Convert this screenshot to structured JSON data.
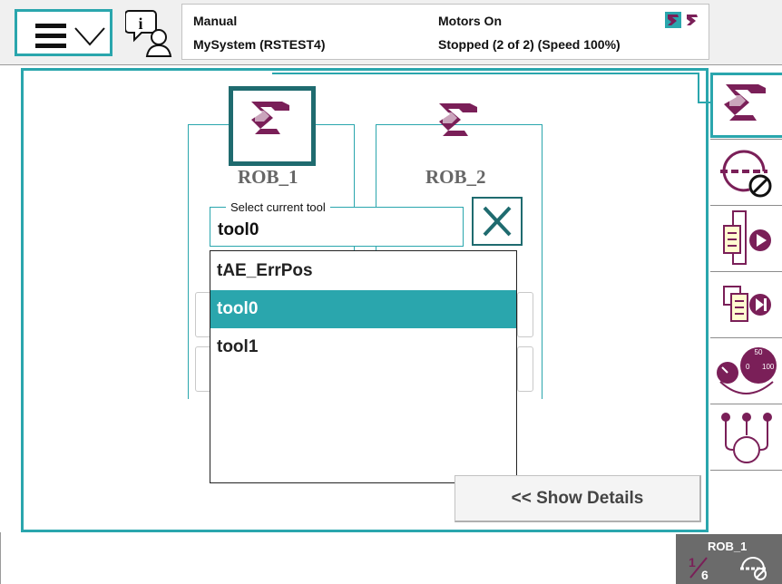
{
  "status": {
    "mode": "Manual",
    "system": "MySystem (RSTEST4)",
    "motors": "Motors On",
    "state": "Stopped (2 of 2) (Speed 100%)"
  },
  "mechanical_units": [
    {
      "label": "ROB_1",
      "selected": true
    },
    {
      "label": "ROB_2",
      "selected": false
    }
  ],
  "tool_select": {
    "legend": "Select current tool",
    "value": "tool0",
    "options": [
      {
        "label": "tAE_ErrPos",
        "selected": false
      },
      {
        "label": "tool0",
        "selected": true
      },
      {
        "label": "tool1",
        "selected": false
      }
    ]
  },
  "show_details": "<< Show Details",
  "quickset": {
    "unit": "ROB_1",
    "increment": "1/6"
  },
  "colors": {
    "accent": "#2aa6ad",
    "accent_dark": "#1f6b6f",
    "icon": "#7a1f58",
    "quickset_bg": "#6b6b6b"
  },
  "rail_icons": [
    "robot-icon",
    "no-increment-icon",
    "run-mode-icon",
    "step-mode-icon",
    "speed-icon",
    "task-select-icon"
  ]
}
